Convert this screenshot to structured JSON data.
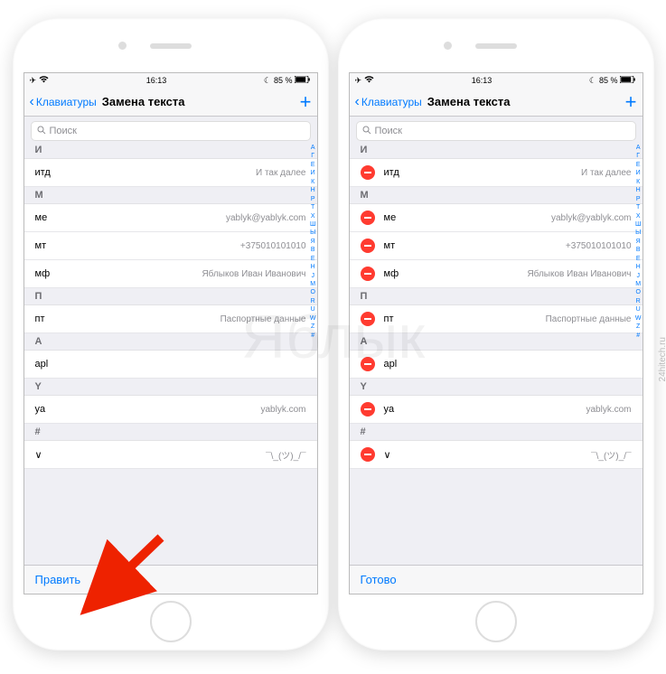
{
  "status": {
    "time": "16:13",
    "battery": "85 %"
  },
  "nav": {
    "back": "Клавиатуры",
    "title": "Замена текста"
  },
  "search": {
    "placeholder": "Поиск"
  },
  "sections": [
    {
      "letter": "И",
      "rows": [
        {
          "shortcut": "итд",
          "phrase": "И так далее"
        }
      ]
    },
    {
      "letter": "М",
      "rows": [
        {
          "shortcut": "ме",
          "phrase": "yablyk@yablyk.com"
        },
        {
          "shortcut": "мт",
          "phrase": "+375010101010"
        },
        {
          "shortcut": "мф",
          "phrase": "Яблыков Иван Иванович"
        }
      ]
    },
    {
      "letter": "П",
      "rows": [
        {
          "shortcut": "пт",
          "phrase": "Паспортные данные"
        }
      ]
    },
    {
      "letter": "A",
      "rows": [
        {
          "shortcut": "apl",
          "phrase": ""
        }
      ]
    },
    {
      "letter": "Y",
      "rows": [
        {
          "shortcut": "ya",
          "phrase": "yablyk.com"
        }
      ]
    },
    {
      "letter": "#",
      "rows": [
        {
          "shortcut": "∨",
          "phrase": "¯\\_(ツ)_/¯"
        }
      ]
    }
  ],
  "index": [
    "А",
    "Г",
    "Е",
    "И",
    "К",
    "Н",
    "Р",
    "Т",
    "Х",
    "Ш",
    "Ы",
    "Я",
    "B",
    "E",
    "H",
    "J",
    "M",
    "O",
    "R",
    "U",
    "W",
    "Z",
    "#"
  ],
  "toolbar": {
    "left_normal": "Править",
    "left_edit": "Готово"
  },
  "watermark": "Яблык",
  "credit": "24hitech.ru"
}
